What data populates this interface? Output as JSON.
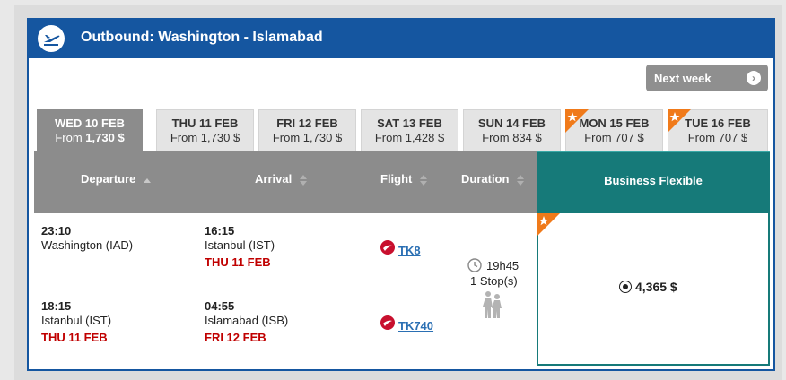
{
  "header": {
    "title": "Outbound: Washington - Islamabad"
  },
  "next_week": {
    "label": "Next week"
  },
  "tabs": [
    {
      "day": "WED 10 FEB",
      "from": "From",
      "price": "1,730 $",
      "active": true,
      "star": false
    },
    {
      "day": "THU 11 FEB",
      "from": "From",
      "price": "1,730 $",
      "active": false,
      "star": false
    },
    {
      "day": "FRI 12 FEB",
      "from": "From",
      "price": "1,730 $",
      "active": false,
      "star": false
    },
    {
      "day": "SAT 13 FEB",
      "from": "From",
      "price": "1,428 $",
      "active": false,
      "star": false
    },
    {
      "day": "SUN 14 FEB",
      "from": "From",
      "price": "834 $",
      "active": false,
      "star": false
    },
    {
      "day": "MON 15 FEB",
      "from": "From",
      "price": "707 $",
      "active": false,
      "star": true
    },
    {
      "day": "TUE 16 FEB",
      "from": "From",
      "price": "707 $",
      "active": false,
      "star": true
    }
  ],
  "columns": {
    "departure": "Departure",
    "arrival": "Arrival",
    "flight": "Flight",
    "duration": "Duration",
    "fare_class": "Business Flexible"
  },
  "segments": [
    {
      "dep_time": "23:10",
      "dep_place": "Washington (IAD)",
      "dep_date": "",
      "arr_time": "16:15",
      "arr_place": "Istanbul (IST)",
      "arr_date": "THU 11 FEB",
      "flight": "TK8"
    },
    {
      "dep_time": "18:15",
      "dep_place": "Istanbul (IST)",
      "dep_date": "THU 11 FEB",
      "arr_time": "04:55",
      "arr_place": "Islamabad (ISB)",
      "arr_date": "FRI 12 FEB",
      "flight": "TK740"
    }
  ],
  "duration": {
    "total": "19h45",
    "stops": "1 Stop(s)"
  },
  "fare": {
    "price": "4,365 $",
    "selected": true
  },
  "colors": {
    "brand_blue": "#1556a0",
    "teal": "#167a79",
    "date_red": "#c00000",
    "star_orange": "#f07a1a"
  }
}
